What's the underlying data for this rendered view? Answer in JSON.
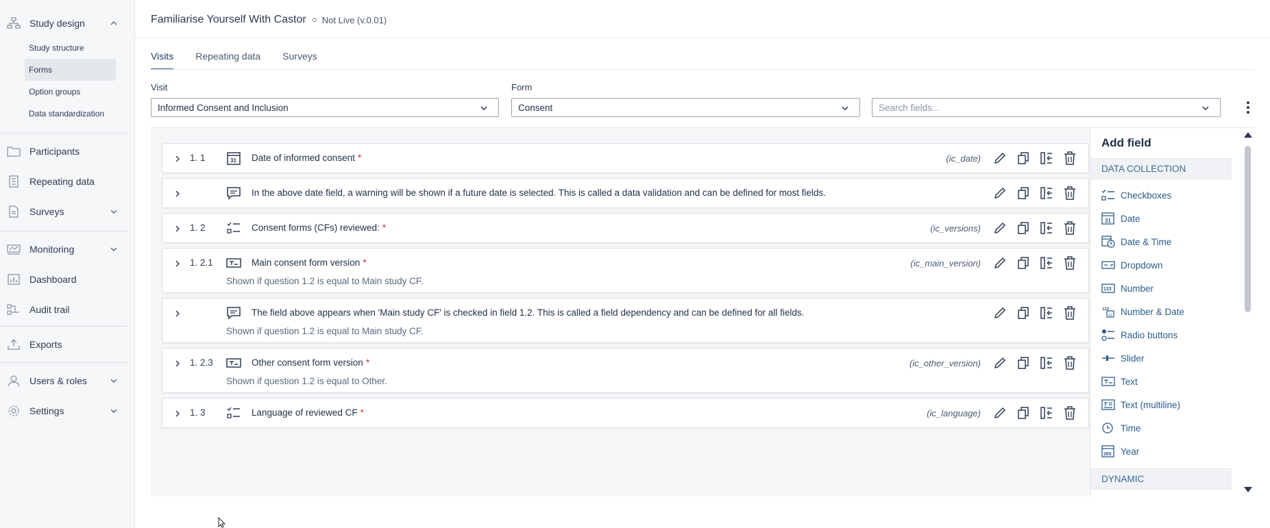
{
  "sidebar": {
    "study_design": "Study design",
    "sub_items": [
      "Study structure",
      "Forms",
      "Option groups",
      "Data standardization"
    ],
    "participants": "Participants",
    "repeating_data": "Repeating data",
    "surveys": "Surveys",
    "monitoring": "Monitoring",
    "dashboard": "Dashboard",
    "audit_trail": "Audit trail",
    "exports": "Exports",
    "users_roles": "Users & roles",
    "settings": "Settings"
  },
  "header": {
    "title": "Familiarise Yourself With Castor",
    "status": "Not Live (v.0.01)"
  },
  "tabs": [
    "Visits",
    "Repeating data",
    "Surveys"
  ],
  "filters": {
    "visit_label": "Visit",
    "visit_value": "Informed Consent and Inclusion",
    "form_label": "Form",
    "form_value": "Consent",
    "search_placeholder": "Search fields..."
  },
  "fields": [
    {
      "num": "1. 1",
      "icon": "calendar-icon",
      "label": "Date of informed consent",
      "req": "*",
      "var": "(ic_date)",
      "dep": ""
    },
    {
      "num": "",
      "icon": "remark-icon",
      "label": "In the above date field, a warning will be shown if a future date is selected. This is called a data validation and can be defined for most fields.",
      "req": "",
      "var": "",
      "dep": ""
    },
    {
      "num": "1. 2",
      "icon": "checklist-icon",
      "label": "Consent forms (CFs) reviewed:",
      "req": "*",
      "var": "(ic_versions)",
      "dep": ""
    },
    {
      "num": "1. 2.1",
      "icon": "text-field-icon",
      "label": "Main consent form version",
      "req": "*",
      "var": "(ic_main_version)",
      "dep": "Shown if question 1.2 is equal to Main study CF."
    },
    {
      "num": "",
      "icon": "remark-icon",
      "label": "The field above appears when 'Main study CF' is checked in field 1.2. This is called a field dependency and can be defined for all fields.",
      "req": "",
      "var": "",
      "dep": "Shown if question 1.2 is equal to Main study CF."
    },
    {
      "num": "1. 2.3",
      "icon": "text-field-icon",
      "label": "Other consent form version",
      "req": "*",
      "var": "(ic_other_version)",
      "dep": "Shown if question 1.2 is equal to Other."
    },
    {
      "num": "1. 3",
      "icon": "checklist-icon",
      "label": "Language of reviewed CF",
      "req": "*",
      "var": "(ic_language)",
      "dep": ""
    }
  ],
  "panel": {
    "title": "Add field",
    "section1": "DATA COLLECTION",
    "items": [
      "Checkboxes",
      "Date",
      "Date & Time",
      "Dropdown",
      "Number",
      "Number & Date",
      "Radio buttons",
      "Slider",
      "Text",
      "Text (multiline)",
      "Time",
      "Year"
    ],
    "section2": "DYNAMIC"
  }
}
